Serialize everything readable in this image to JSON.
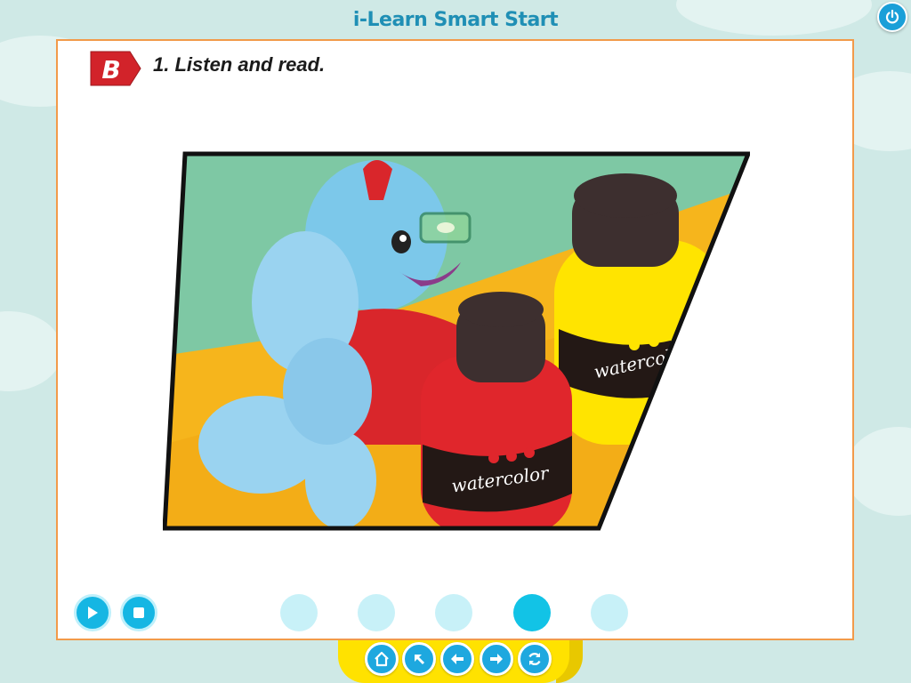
{
  "app": {
    "title": "i-Learn Smart Start"
  },
  "header": {
    "power_icon": "power-icon"
  },
  "exercise": {
    "badge_letter": "B",
    "instruction": "1. Listen and read.",
    "image_text": {
      "bottle_label_yellow": "watercolor",
      "bottle_label_red": "watercolor"
    }
  },
  "audio_controls": {
    "play_icon": "play-icon",
    "stop_icon": "stop-icon"
  },
  "pager": {
    "dots": 5,
    "active_index": 3
  },
  "nav": {
    "buttons": [
      "home-icon",
      "arrow-up-left-icon",
      "arrow-left-icon",
      "arrow-right-icon",
      "refresh-icon"
    ]
  },
  "colors": {
    "accent": "#1a9fd8",
    "panel_border": "#f29a4a",
    "badge": "#d2232a",
    "nav_bar": "#ffe200",
    "dot_active": "#12c3e6",
    "dot_inactive": "#c8f1f8"
  }
}
